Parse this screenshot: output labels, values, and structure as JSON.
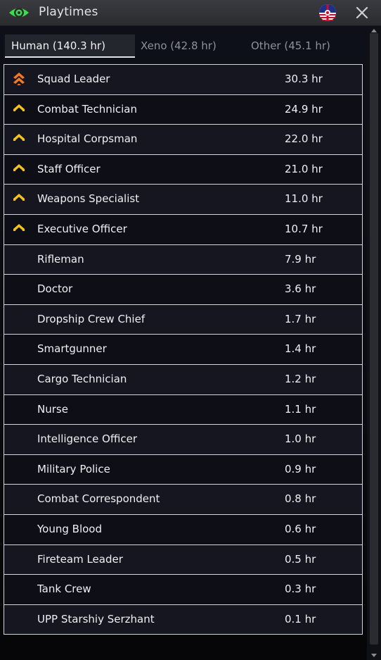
{
  "window": {
    "title": "Playtimes",
    "eye_icon": "eye-icon",
    "flag_icon": "uscm-flag-icon",
    "close_icon": "close-icon",
    "colors": {
      "eye": "#3ddc4b",
      "accent_gold": "#f4c21a",
      "accent_orange": "#f07a2a"
    }
  },
  "tabs": [
    {
      "label": "Human (140.3 hr)",
      "active": true
    },
    {
      "label": "Xeno (42.8 hr)",
      "active": false
    },
    {
      "label": "Other (45.1 hr)",
      "active": false
    }
  ],
  "rows": [
    {
      "name": "Squad Leader",
      "hours": "30.3 hr",
      "icon": "double-chevron-rank-icon"
    },
    {
      "name": "Combat Technician",
      "hours": "24.9 hr",
      "icon": "chevron-rank-icon"
    },
    {
      "name": "Hospital Corpsman",
      "hours": "22.0 hr",
      "icon": "chevron-rank-icon"
    },
    {
      "name": "Staff Officer",
      "hours": "21.0 hr",
      "icon": "chevron-rank-icon"
    },
    {
      "name": "Weapons Specialist",
      "hours": "11.0 hr",
      "icon": "chevron-rank-icon"
    },
    {
      "name": "Executive Officer",
      "hours": "10.7 hr",
      "icon": "chevron-rank-icon"
    },
    {
      "name": "Rifleman",
      "hours": "7.9 hr",
      "icon": ""
    },
    {
      "name": "Doctor",
      "hours": "3.6 hr",
      "icon": ""
    },
    {
      "name": "Dropship Crew Chief",
      "hours": "1.7 hr",
      "icon": ""
    },
    {
      "name": "Smartgunner",
      "hours": "1.4 hr",
      "icon": ""
    },
    {
      "name": "Cargo Technician",
      "hours": "1.2 hr",
      "icon": ""
    },
    {
      "name": "Nurse",
      "hours": "1.1 hr",
      "icon": ""
    },
    {
      "name": "Intelligence Officer",
      "hours": "1.0 hr",
      "icon": ""
    },
    {
      "name": "Military Police",
      "hours": "0.9 hr",
      "icon": ""
    },
    {
      "name": "Combat Correspondent",
      "hours": "0.8 hr",
      "icon": ""
    },
    {
      "name": "Young Blood",
      "hours": "0.6 hr",
      "icon": ""
    },
    {
      "name": "Fireteam Leader",
      "hours": "0.5 hr",
      "icon": ""
    },
    {
      "name": "Tank Crew",
      "hours": "0.3 hr",
      "icon": ""
    },
    {
      "name": "UPP Starshiy Serzhant",
      "hours": "0.1 hr",
      "icon": ""
    }
  ]
}
